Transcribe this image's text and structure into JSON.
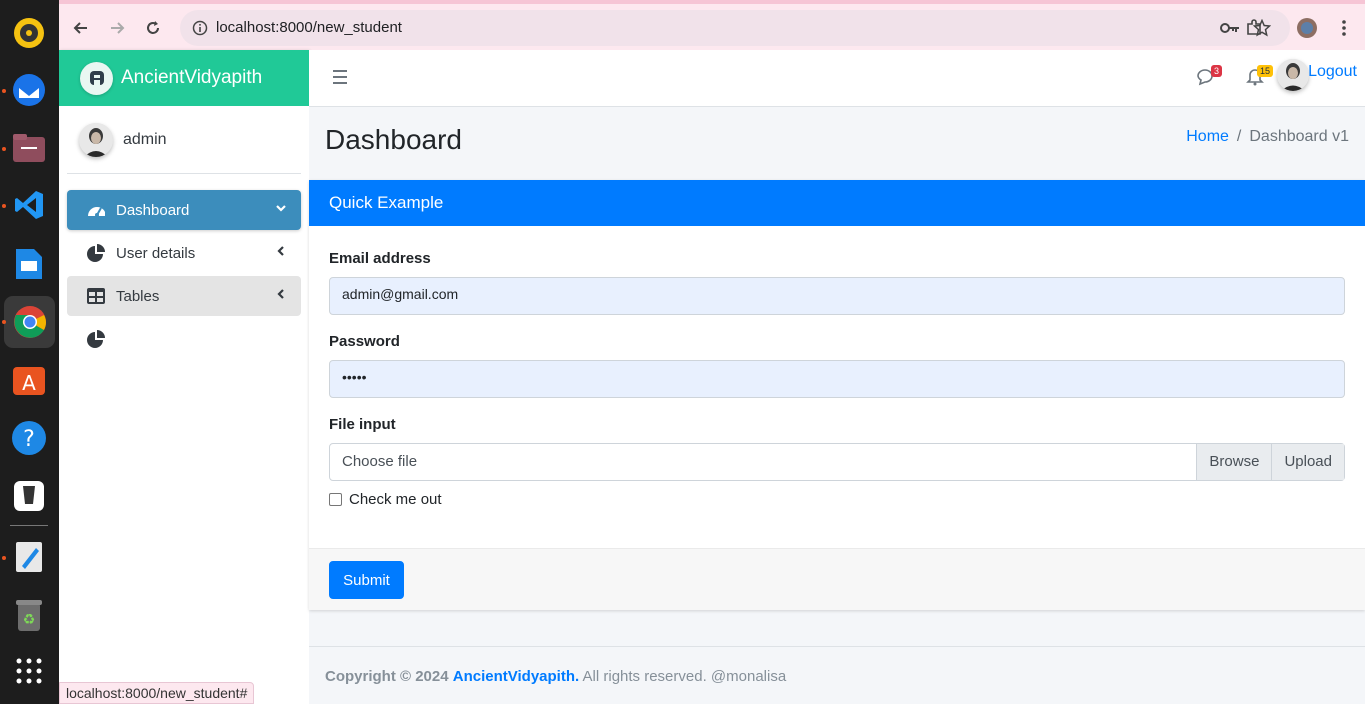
{
  "browser": {
    "url": "localhost:8000/new_student",
    "status_url": "localhost:8000/new_student#"
  },
  "dock": {
    "apps": [
      "rhythmbox-icon",
      "thunderbird-icon",
      "files-icon",
      "vscode-icon",
      "libreoffice-impress-icon",
      "chrome-icon",
      "app-center-icon",
      "help-icon",
      "inkscape-icon",
      "text-editor-icon",
      "trash-icon",
      "app-grid-icon"
    ]
  },
  "sidebar": {
    "brand": "AncientVidyapith",
    "user": "admin",
    "items": [
      {
        "label": "Dashboard",
        "icon": "tachometer-icon"
      },
      {
        "label": "User details",
        "icon": "pie-chart-icon"
      },
      {
        "label": "Tables",
        "icon": "table-icon"
      },
      {
        "label": "",
        "icon": "pie-chart-icon"
      }
    ]
  },
  "topbar": {
    "messages_count": "3",
    "notifications_count": "15",
    "logout_label": "Logout"
  },
  "page": {
    "title": "Dashboard",
    "breadcrumb_home": "Home",
    "breadcrumb_sep": "/",
    "breadcrumb_current": "Dashboard v1"
  },
  "card": {
    "header": "Quick Example",
    "email_label": "Email address",
    "email_value": "admin@gmail.com",
    "password_label": "Password",
    "password_value": "•••••",
    "file_label": "File input",
    "file_placeholder": "Choose file",
    "browse_label": "Browse",
    "upload_label": "Upload",
    "check_label": "Check me out",
    "submit_label": "Submit"
  },
  "footer": {
    "copyright": "Copyright © 2024",
    "brand": "AncientVidyapith.",
    "rights": "All rights reserved. @monalisa"
  },
  "colors": {
    "brand": "#20c997",
    "active_nav": "#3c8dbc",
    "primary": "#007bff"
  }
}
